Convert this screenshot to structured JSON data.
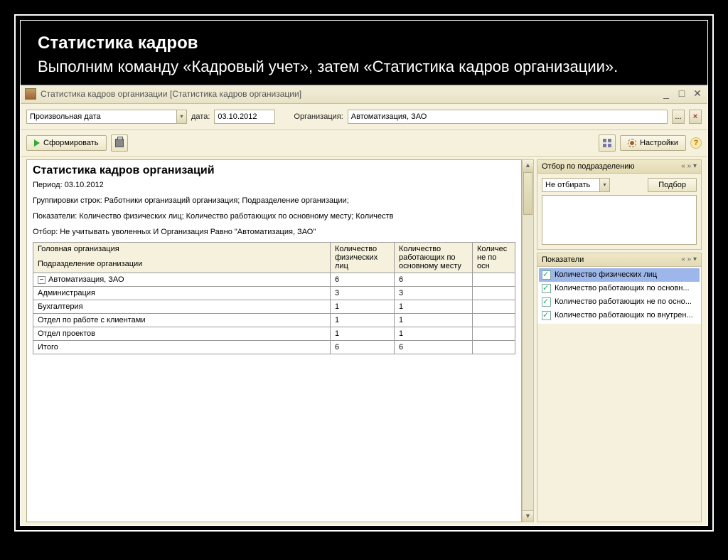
{
  "slide": {
    "title": "Статистика кадров",
    "description": "Выполним команду «Кадровый учет», затем «Статистика кадров организации»."
  },
  "window": {
    "title": "Статистика кадров организации [Статистика кадров организации]"
  },
  "params": {
    "period_type": "Произвольная дата",
    "date_label": "дата:",
    "date": "03.10.2012",
    "org_label": "Организация:",
    "org": "Автоматизация, ЗАО"
  },
  "toolbar": {
    "generate": "Сформировать",
    "settings": "Настройки"
  },
  "report": {
    "title": "Статистика кадров организаций",
    "period": "Период: 03.10.2012",
    "groupings": "Группировки строк: Работники организаций организация; Подразделение организации;",
    "indicators": "Показатели: Количество физических лиц; Количество работающих по основному месту; Количеств",
    "filter": "Отбор: Не учитывать уволенных И Организация Равно \"Автоматизация, ЗАО\"",
    "cols": {
      "h1a": "Головная организация",
      "h1b": "Подразделение организации",
      "c1": "Количество физических лиц",
      "c2": "Количество работающих по основному месту",
      "c3": "Количес не по осн"
    },
    "rows": [
      {
        "label": "Автоматизация, ЗАО",
        "v1": "6",
        "v2": "6",
        "group": true
      },
      {
        "label": "Администрация",
        "v1": "3",
        "v2": "3"
      },
      {
        "label": "Бухгалтерия",
        "v1": "1",
        "v2": "1"
      },
      {
        "label": "Отдел по работе с клиентами",
        "v1": "1",
        "v2": "1"
      },
      {
        "label": "Отдел проектов",
        "v1": "1",
        "v2": "1"
      }
    ],
    "total_label": "Итого",
    "total": {
      "v1": "6",
      "v2": "6"
    }
  },
  "sidepanels": {
    "filter_title": "Отбор по подразделению",
    "filter_mode": "Не отбирать",
    "filter_pick": "Подбор",
    "indicators_title": "Показатели",
    "indicators": [
      "Количество физических лиц",
      "Количество работающих по основн...",
      "Количество работающих не по осно...",
      "Количество работающих по внутрен..."
    ]
  }
}
